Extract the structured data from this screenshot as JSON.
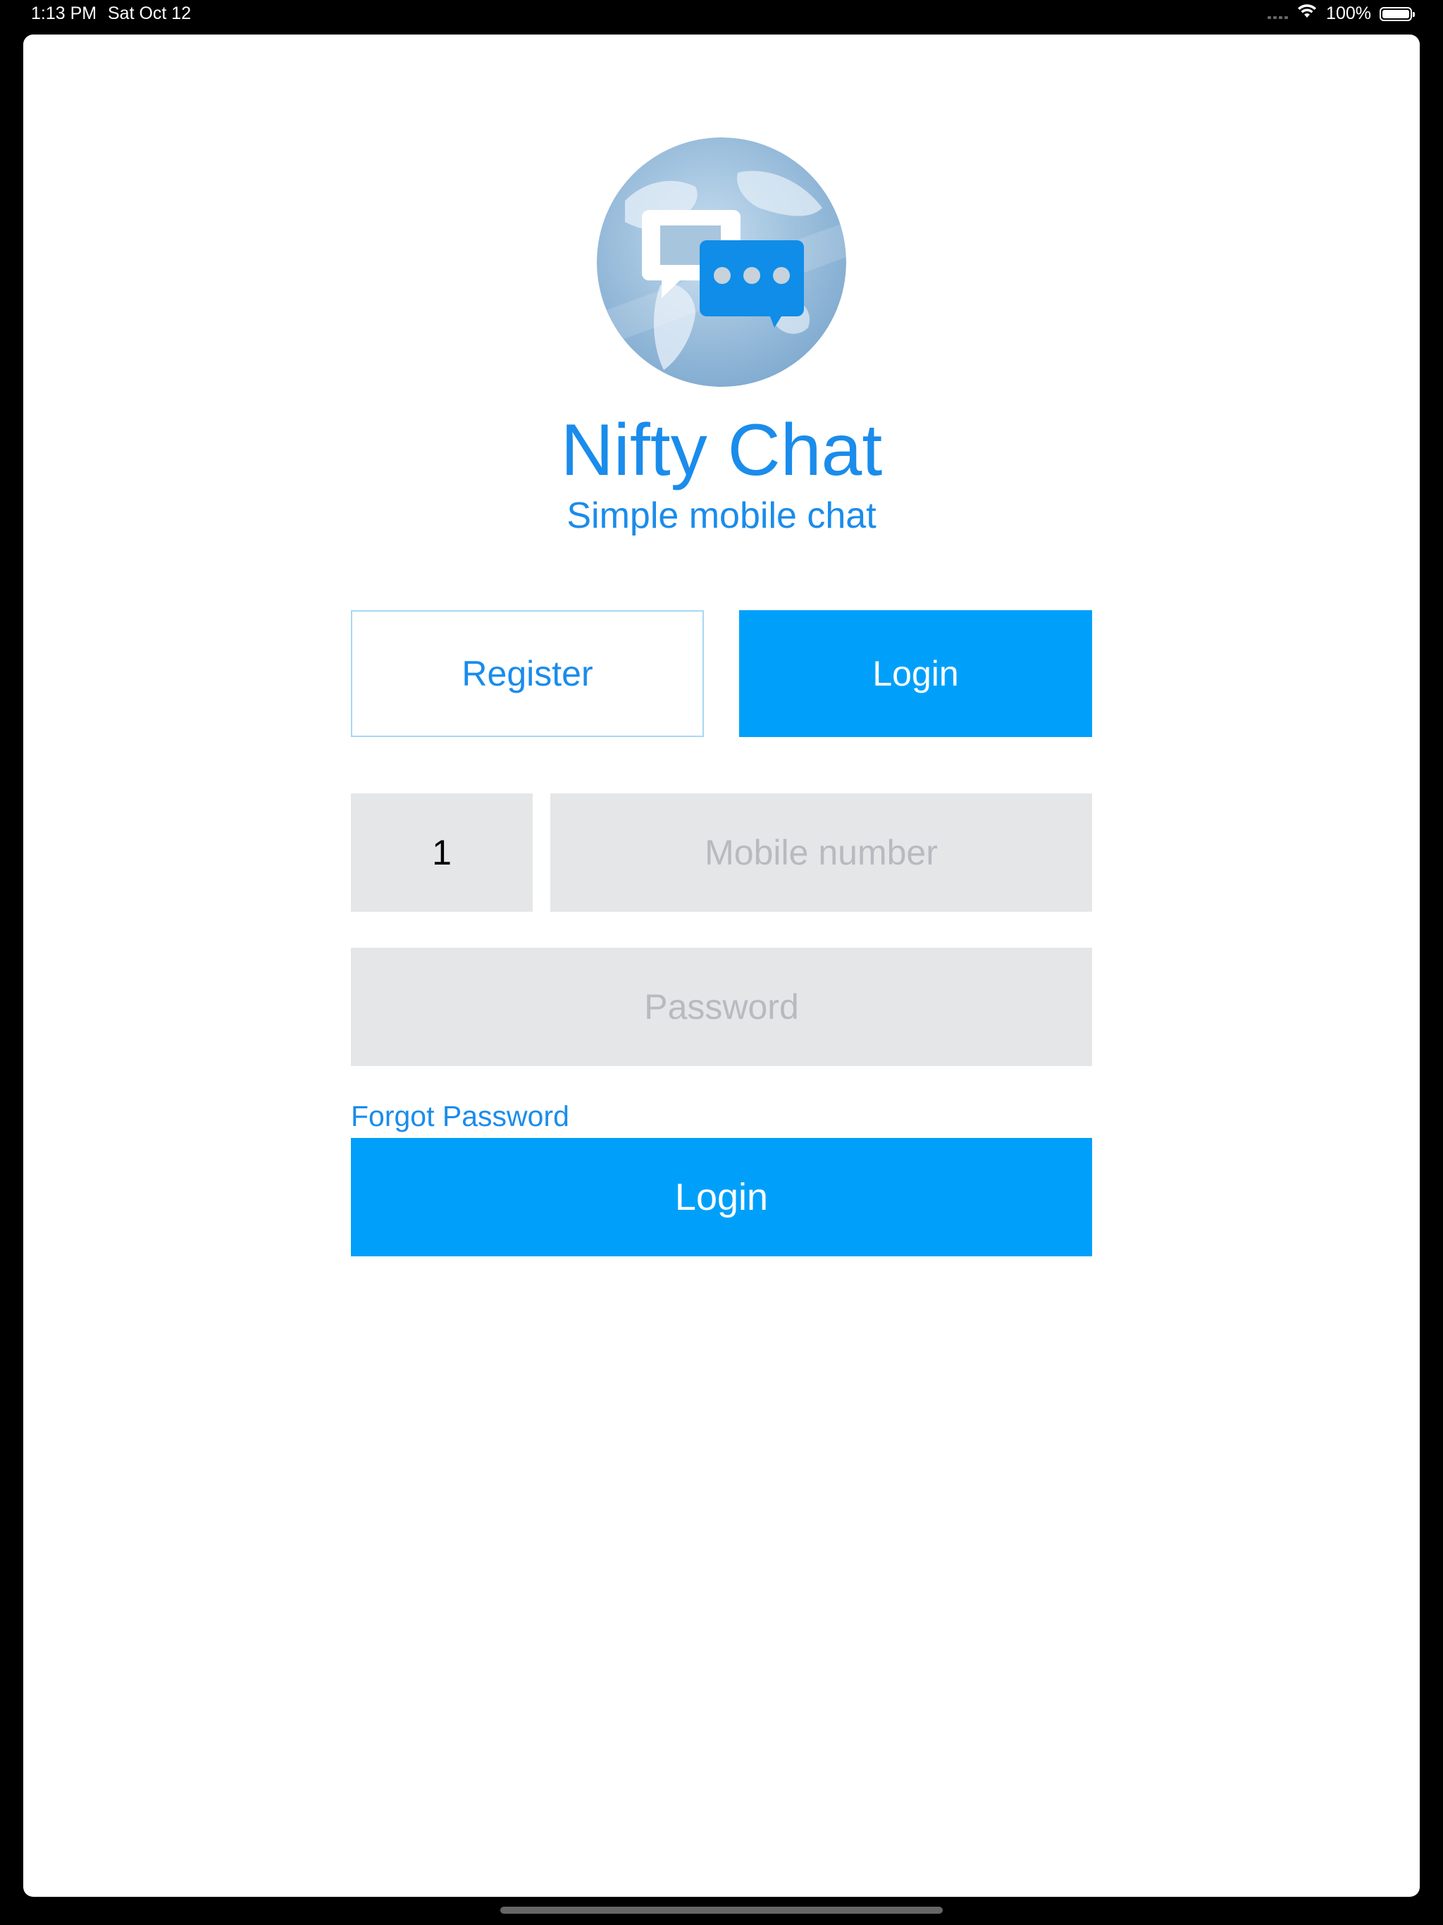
{
  "status_bar": {
    "time": "1:13 PM",
    "date": "Sat Oct 12",
    "battery": "100%",
    "icons": [
      "cellular-dots-icon",
      "wifi-icon",
      "battery-icon"
    ]
  },
  "app": {
    "title": "Nifty Chat",
    "subtitle": "Simple mobile chat",
    "logo_icon": "globe-chat-logo-icon"
  },
  "tabs": {
    "register_label": "Register",
    "login_label": "Login",
    "active": "Login"
  },
  "form": {
    "country_code": "1",
    "mobile_placeholder": "Mobile number",
    "password_placeholder": "Password",
    "forgot_password": "Forgot Password",
    "submit_label": "Login"
  },
  "colors": {
    "accent": "#00a0fa",
    "text_accent": "#1a8ceb",
    "field_bg": "#e5e6e8",
    "placeholder": "#b7babf"
  }
}
